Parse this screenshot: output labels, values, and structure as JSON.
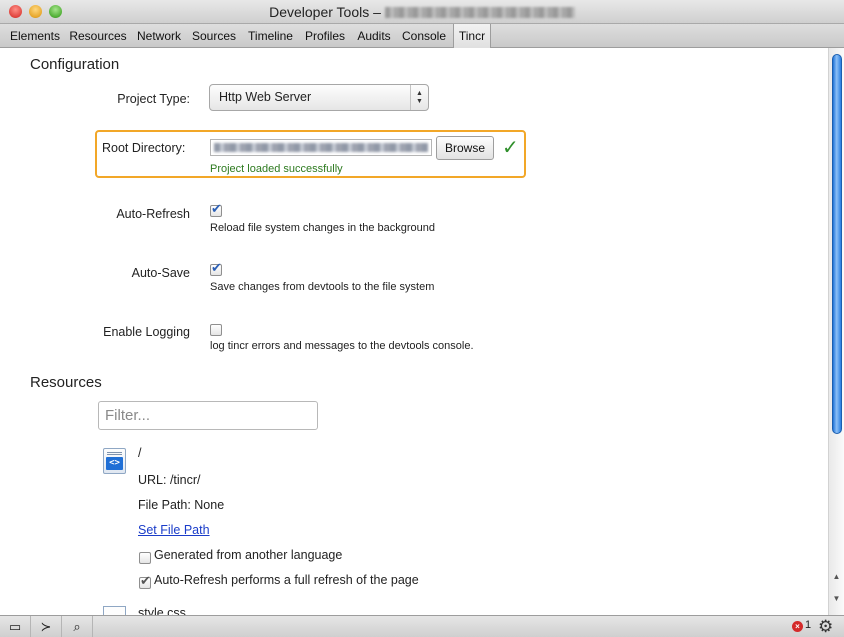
{
  "window": {
    "title": "Developer Tools –"
  },
  "tabs": [
    "Elements",
    "Resources",
    "Network",
    "Sources",
    "Timeline",
    "Profiles",
    "Audits",
    "Console",
    "Tincr"
  ],
  "configuration": {
    "title": "Configuration",
    "project_type_label": "Project Type:",
    "project_type_value": "Http Web Server",
    "root_directory_label": "Root Directory:",
    "browse_label": "Browse",
    "status_message": "Project loaded successfully",
    "auto_refresh_label": "Auto-Refresh",
    "auto_refresh_checked": true,
    "auto_refresh_desc": "Reload file system changes in the background",
    "auto_save_label": "Auto-Save",
    "auto_save_checked": true,
    "auto_save_desc": "Save changes from devtools to the file system",
    "logging_label": "Enable Logging",
    "logging_checked": false,
    "logging_desc": "log tincr errors and messages to the devtools console."
  },
  "resources": {
    "title": "Resources",
    "filter_placeholder": "Filter...",
    "item": {
      "name": "/",
      "url": "URL: /tincr/",
      "file_path": "File Path: None",
      "set_file_path": "Set File Path",
      "generated_label": "Generated from another language",
      "generated_checked": false,
      "full_refresh_label": "Auto-Refresh performs a full refresh of the page",
      "full_refresh_checked": true
    },
    "next_item_name": "style.css"
  },
  "statusbar": {
    "error_count": "1"
  },
  "colors": {
    "highlight_border": "#f2a728",
    "success_green": "#2d7a1f",
    "link_blue": "#1a3cc9"
  }
}
